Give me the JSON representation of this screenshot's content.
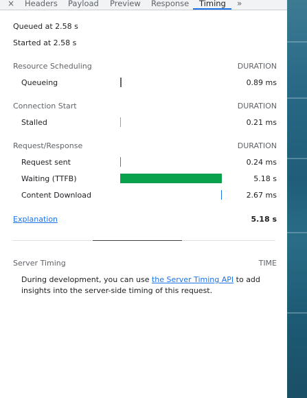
{
  "tabs": {
    "close": "×",
    "items": [
      "Headers",
      "Payload",
      "Preview",
      "Response",
      "Timing"
    ],
    "active": "Timing",
    "more": "»"
  },
  "queued": "Queued at 2.58 s",
  "started": "Started at 2.58 s",
  "sections": [
    {
      "title": "Resource Scheduling",
      "duration_header": "DURATION",
      "rows": [
        {
          "label": "Queueing",
          "value": "0.89 ms"
        }
      ]
    },
    {
      "title": "Connection Start",
      "duration_header": "DURATION",
      "rows": [
        {
          "label": "Stalled",
          "value": "0.21 ms"
        }
      ]
    },
    {
      "title": "Request/Response",
      "duration_header": "DURATION",
      "rows": [
        {
          "label": "Request sent",
          "value": "0.24 ms"
        },
        {
          "label": "Waiting (TTFB)",
          "value": "5.18 s"
        },
        {
          "label": "Content Download",
          "value": "2.67 ms"
        }
      ]
    }
  ],
  "explanation_link": "Explanation",
  "total": "5.18 s",
  "server_timing": {
    "title": "Server Timing",
    "time_header": "TIME",
    "desc_before": "During development, you can use ",
    "desc_link": "the Server Timing API",
    "desc_after": " to add insights into the server-side timing of this request."
  },
  "colors": {
    "ttfb_bar": "#0aa14d",
    "queueing_tick": "#5f6368",
    "stalled_tick": "#9aa0a6",
    "request_tick": "#2e8b9a",
    "download_tick": "#1a73e8",
    "link": "#1a73e8"
  }
}
